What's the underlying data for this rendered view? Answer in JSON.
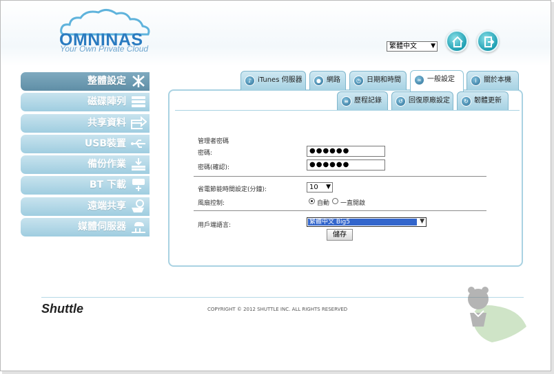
{
  "brand": {
    "logo_text": "OMNINAS",
    "tagline": "Your Own Private Cloud",
    "footer_brand": "Shuttle",
    "copyright": "COPYRIGHT © 2012 SHUTTLE INC. ALL RIGHTS RESERVED"
  },
  "header": {
    "language_value": "繁體中文"
  },
  "sidebar": {
    "items": [
      {
        "label": "整體設定",
        "icon": "tools-icon",
        "active": true
      },
      {
        "label": "磁碟陣列",
        "icon": "disk-stack-icon"
      },
      {
        "label": "共享資料",
        "icon": "share-arrow-icon"
      },
      {
        "label": "USB裝置",
        "icon": "usb-icon"
      },
      {
        "label": "備份作業",
        "icon": "backup-icon"
      },
      {
        "label": "BT 下載",
        "icon": "bt-download-icon"
      },
      {
        "label": "遠端共享",
        "icon": "remote-share-icon"
      },
      {
        "label": "媒體伺服器",
        "icon": "media-server-icon"
      }
    ]
  },
  "tabs": [
    {
      "label": "iTunes 伺服器"
    },
    {
      "label": "網路"
    },
    {
      "label": "日期和時間"
    },
    {
      "label": "一般設定",
      "active": true
    },
    {
      "label": "關於本機"
    }
  ],
  "subtabs": [
    {
      "label": "歷程記錄"
    },
    {
      "label": "回復原廠設定"
    },
    {
      "label": "韌體更新"
    }
  ],
  "form": {
    "admin_pw_heading": "管理者密碼",
    "pw_label": "密碼:",
    "pw_value": "●●●●●●",
    "pw_confirm_label": "密碼(確認):",
    "pw_confirm_value": "●●●●●●",
    "power_label": "省電節能時間設定(分鐘):",
    "power_value": "10",
    "fan_label": "風扇控制:",
    "fan_auto": "自動",
    "fan_always": "一直開啟",
    "client_lang_label": "用戶端語言:",
    "client_lang_value": "繁體中文 Big5",
    "save": "儲存"
  },
  "colors": {
    "accent": "#2a7bc0",
    "sidebar_active": "#6b98ae",
    "sidebar": "#b3d9e8",
    "panel_border": "#a9d2e2"
  }
}
